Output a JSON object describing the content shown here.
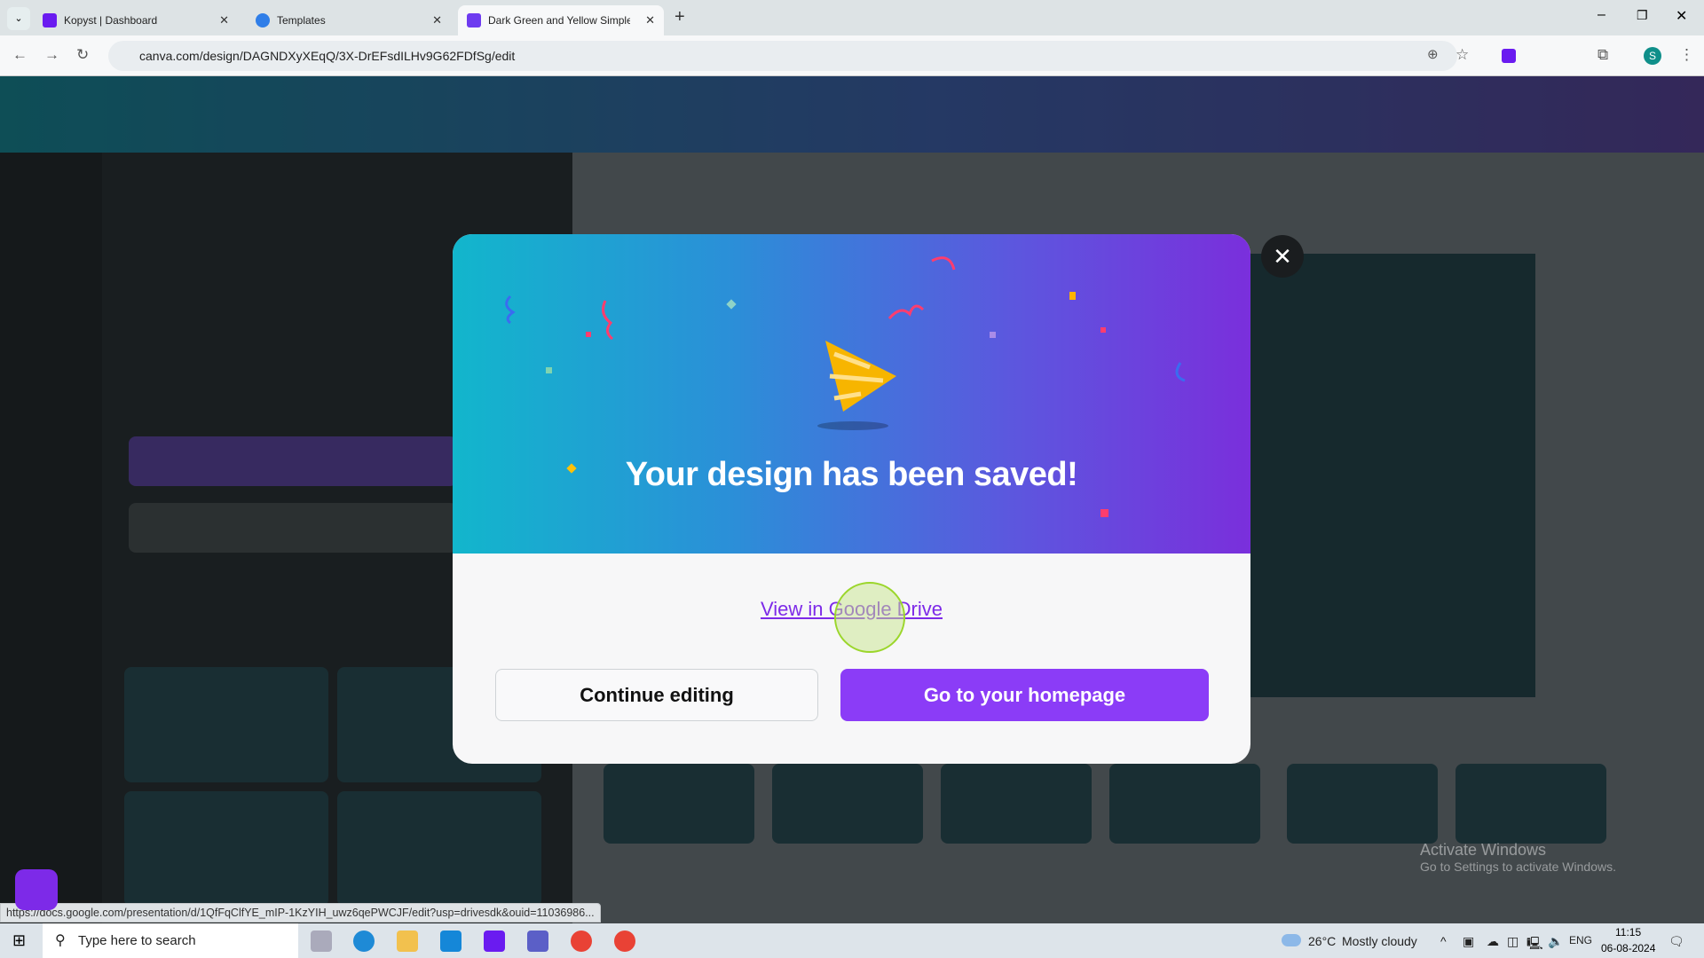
{
  "browser": {
    "tabs": [
      {
        "label": "Kopyst | Dashboard",
        "icon": "kopyst-icon",
        "color": "#6a1bf0"
      },
      {
        "label": "Templates",
        "icon": "canva-icon",
        "color": "#2f7ee8"
      },
      {
        "label": "Dark Green and Yellow Simple M",
        "icon": "canva-presentation-icon",
        "color": "#6e3bf0"
      }
    ],
    "url": "canva.com/design/DAGNDXyXEqQ/3X-DrEFsdILHv9G62FDfSg/edit",
    "status_url": "https://docs.google.com/presentation/d/1QfFqClfYE_mIP-1KzYIH_uwz6qePWCJF/edit?usp=drivesdk&ouid=11036986..."
  },
  "modal": {
    "title": "Your design has been saved!",
    "link": "View in Google Drive",
    "continue_label": "Continue editing",
    "homepage_label": "Go to your homepage",
    "close": "✕",
    "accent": "#8b3cf7"
  },
  "watermark": {
    "title": "Activate Windows",
    "subtitle": "Go to Settings to activate Windows."
  },
  "taskbar": {
    "search_placeholder": "Type here to search",
    "weather": "26°C",
    "weather_desc": "Mostly cloudy",
    "lang": "ENG",
    "time": "11:15",
    "date": "06-08-2024"
  }
}
